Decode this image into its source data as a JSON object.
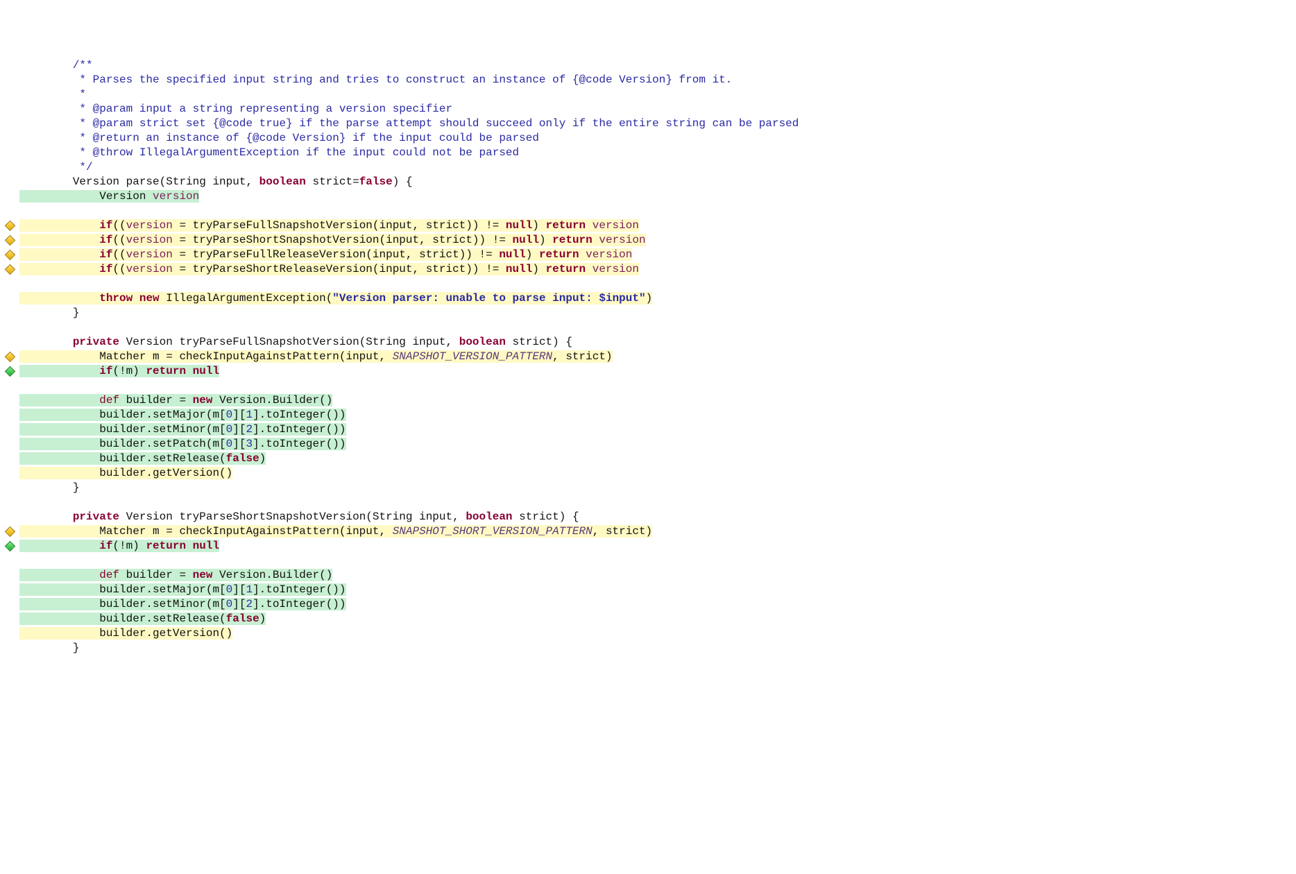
{
  "colors": {
    "keyword": "#880033",
    "comment": "#2a2aa5",
    "string": "#2a2aa5",
    "number": "#2a2aa5",
    "constant": "#5a3a7a",
    "field": "#7a1f5a",
    "bg_green": "#c7f0d2",
    "bg_yellow": "#fff9c4"
  },
  "lines": [
    {
      "gutter": "",
      "segs": [
        {
          "t": "        /**",
          "cls": "t-comment",
          "bg": "bg-none"
        }
      ]
    },
    {
      "gutter": "",
      "segs": [
        {
          "t": "         * Parses the specified input string and tries to construct an instance of {@code Version} from it.",
          "cls": "t-comment",
          "bg": "bg-none"
        }
      ]
    },
    {
      "gutter": "",
      "segs": [
        {
          "t": "         *",
          "cls": "t-comment",
          "bg": "bg-none"
        }
      ]
    },
    {
      "gutter": "",
      "segs": [
        {
          "t": "         * @param input a string representing a version specifier",
          "cls": "t-comment",
          "bg": "bg-none"
        }
      ]
    },
    {
      "gutter": "",
      "segs": [
        {
          "t": "         * @param strict set {@code true} if the parse attempt should succeed only if the entire string can be parsed",
          "cls": "t-comment",
          "bg": "bg-none"
        }
      ]
    },
    {
      "gutter": "",
      "segs": [
        {
          "t": "         * @return an instance of {@code Version} if the input could be parsed",
          "cls": "t-comment",
          "bg": "bg-none"
        }
      ]
    },
    {
      "gutter": "",
      "segs": [
        {
          "t": "         * @throw IllegalArgumentException if the input could not be parsed",
          "cls": "t-comment",
          "bg": "bg-none"
        }
      ]
    },
    {
      "gutter": "",
      "segs": [
        {
          "t": "         */",
          "cls": "t-comment",
          "bg": "bg-none"
        }
      ]
    },
    {
      "gutter": "",
      "segs": [
        {
          "t": "        ",
          "cls": "t-plain",
          "bg": "bg-none"
        },
        {
          "t": "Version parse(String input, ",
          "cls": "t-plain",
          "bg": "bg-none"
        },
        {
          "t": "boolean",
          "cls": "t-keyword",
          "bg": "bg-none"
        },
        {
          "t": " strict=",
          "cls": "t-plain",
          "bg": "bg-none"
        },
        {
          "t": "false",
          "cls": "t-keyword",
          "bg": "bg-none"
        },
        {
          "t": ") {",
          "cls": "t-plain",
          "bg": "bg-none"
        }
      ]
    },
    {
      "gutter": "",
      "segs": [
        {
          "t": "            Version ",
          "cls": "t-plain",
          "bg": "bg-green"
        },
        {
          "t": "version",
          "cls": "t-field",
          "bg": "bg-green"
        }
      ]
    },
    {
      "gutter": "",
      "segs": [
        {
          "t": " ",
          "cls": "t-plain",
          "bg": "bg-none"
        }
      ]
    },
    {
      "gutter": "yellow",
      "segs": [
        {
          "t": "            ",
          "cls": "t-plain",
          "bg": "bg-yellow"
        },
        {
          "t": "if",
          "cls": "t-keyword",
          "bg": "bg-yellow"
        },
        {
          "t": "((",
          "cls": "t-plain",
          "bg": "bg-yellow"
        },
        {
          "t": "version",
          "cls": "t-field",
          "bg": "bg-yellow"
        },
        {
          "t": " = tryParseFullSnapshotVersion(input, strict)) != ",
          "cls": "t-plain",
          "bg": "bg-yellow"
        },
        {
          "t": "null",
          "cls": "t-keyword",
          "bg": "bg-yellow"
        },
        {
          "t": ") ",
          "cls": "t-plain",
          "bg": "bg-yellow"
        },
        {
          "t": "return",
          "cls": "t-keyword",
          "bg": "bg-yellow"
        },
        {
          "t": " ",
          "cls": "t-plain",
          "bg": "bg-yellow"
        },
        {
          "t": "version",
          "cls": "t-field",
          "bg": "bg-yellow"
        }
      ]
    },
    {
      "gutter": "yellow",
      "segs": [
        {
          "t": "            ",
          "cls": "t-plain",
          "bg": "bg-yellow"
        },
        {
          "t": "if",
          "cls": "t-keyword",
          "bg": "bg-yellow"
        },
        {
          "t": "((",
          "cls": "t-plain",
          "bg": "bg-yellow"
        },
        {
          "t": "version",
          "cls": "t-field",
          "bg": "bg-yellow"
        },
        {
          "t": " = tryParseShortSnapshotVersion(input, strict)) != ",
          "cls": "t-plain",
          "bg": "bg-yellow"
        },
        {
          "t": "null",
          "cls": "t-keyword",
          "bg": "bg-yellow"
        },
        {
          "t": ") ",
          "cls": "t-plain",
          "bg": "bg-yellow"
        },
        {
          "t": "return",
          "cls": "t-keyword",
          "bg": "bg-yellow"
        },
        {
          "t": " ",
          "cls": "t-plain",
          "bg": "bg-yellow"
        },
        {
          "t": "version",
          "cls": "t-field",
          "bg": "bg-yellow"
        }
      ]
    },
    {
      "gutter": "yellow",
      "segs": [
        {
          "t": "            ",
          "cls": "t-plain",
          "bg": "bg-yellow"
        },
        {
          "t": "if",
          "cls": "t-keyword",
          "bg": "bg-yellow"
        },
        {
          "t": "((",
          "cls": "t-plain",
          "bg": "bg-yellow"
        },
        {
          "t": "version",
          "cls": "t-field",
          "bg": "bg-yellow"
        },
        {
          "t": " = tryParseFullReleaseVersion(input, strict)) != ",
          "cls": "t-plain",
          "bg": "bg-yellow"
        },
        {
          "t": "null",
          "cls": "t-keyword",
          "bg": "bg-yellow"
        },
        {
          "t": ") ",
          "cls": "t-plain",
          "bg": "bg-yellow"
        },
        {
          "t": "return",
          "cls": "t-keyword",
          "bg": "bg-yellow"
        },
        {
          "t": " ",
          "cls": "t-plain",
          "bg": "bg-yellow"
        },
        {
          "t": "version",
          "cls": "t-field",
          "bg": "bg-yellow"
        }
      ]
    },
    {
      "gutter": "yellow",
      "segs": [
        {
          "t": "            ",
          "cls": "t-plain",
          "bg": "bg-yellow"
        },
        {
          "t": "if",
          "cls": "t-keyword",
          "bg": "bg-yellow"
        },
        {
          "t": "((",
          "cls": "t-plain",
          "bg": "bg-yellow"
        },
        {
          "t": "version",
          "cls": "t-field",
          "bg": "bg-yellow"
        },
        {
          "t": " = tryParseShortReleaseVersion(input, strict)) != ",
          "cls": "t-plain",
          "bg": "bg-yellow"
        },
        {
          "t": "null",
          "cls": "t-keyword",
          "bg": "bg-yellow"
        },
        {
          "t": ") ",
          "cls": "t-plain",
          "bg": "bg-yellow"
        },
        {
          "t": "return",
          "cls": "t-keyword",
          "bg": "bg-yellow"
        },
        {
          "t": " ",
          "cls": "t-plain",
          "bg": "bg-yellow"
        },
        {
          "t": "version",
          "cls": "t-field",
          "bg": "bg-yellow"
        }
      ]
    },
    {
      "gutter": "",
      "segs": [
        {
          "t": " ",
          "cls": "t-plain",
          "bg": "bg-none"
        }
      ]
    },
    {
      "gutter": "",
      "segs": [
        {
          "t": "            ",
          "cls": "t-plain",
          "bg": "bg-yellow"
        },
        {
          "t": "throw",
          "cls": "t-keyword",
          "bg": "bg-yellow"
        },
        {
          "t": " ",
          "cls": "t-plain",
          "bg": "bg-yellow"
        },
        {
          "t": "new",
          "cls": "t-keyword",
          "bg": "bg-yellow"
        },
        {
          "t": " IllegalArgumentException(",
          "cls": "t-plain",
          "bg": "bg-yellow"
        },
        {
          "t": "\"Version parser: unable to parse input: $input\"",
          "cls": "t-string t-bold",
          "bg": "bg-yellow"
        },
        {
          "t": ")",
          "cls": "t-plain",
          "bg": "bg-yellow"
        }
      ]
    },
    {
      "gutter": "",
      "segs": [
        {
          "t": "        }",
          "cls": "t-plain",
          "bg": "bg-none"
        }
      ]
    },
    {
      "gutter": "",
      "segs": [
        {
          "t": " ",
          "cls": "t-plain",
          "bg": "bg-none"
        }
      ]
    },
    {
      "gutter": "",
      "segs": [
        {
          "t": "        ",
          "cls": "t-plain",
          "bg": "bg-none"
        },
        {
          "t": "private",
          "cls": "t-keyword",
          "bg": "bg-none"
        },
        {
          "t": " Version tryParseFullSnapshotVersion(String input, ",
          "cls": "t-plain",
          "bg": "bg-none"
        },
        {
          "t": "boolean",
          "cls": "t-keyword",
          "bg": "bg-none"
        },
        {
          "t": " strict) {",
          "cls": "t-plain",
          "bg": "bg-none"
        }
      ]
    },
    {
      "gutter": "yellow",
      "segs": [
        {
          "t": "            Matcher m = checkInputAgainstPattern(input, ",
          "cls": "t-plain",
          "bg": "bg-yellow"
        },
        {
          "t": "SNAPSHOT_VERSION_PATTERN",
          "cls": "t-const",
          "bg": "bg-yellow"
        },
        {
          "t": ", strict)",
          "cls": "t-plain",
          "bg": "bg-yellow"
        }
      ]
    },
    {
      "gutter": "green",
      "segs": [
        {
          "t": "            ",
          "cls": "t-plain",
          "bg": "bg-green"
        },
        {
          "t": "if",
          "cls": "t-keyword",
          "bg": "bg-green"
        },
        {
          "t": "(!m) ",
          "cls": "t-plain",
          "bg": "bg-green"
        },
        {
          "t": "return",
          "cls": "t-keyword",
          "bg": "bg-green"
        },
        {
          "t": " ",
          "cls": "t-plain",
          "bg": "bg-green"
        },
        {
          "t": "null",
          "cls": "t-keyword",
          "bg": "bg-green"
        }
      ]
    },
    {
      "gutter": "",
      "segs": [
        {
          "t": " ",
          "cls": "t-plain",
          "bg": "bg-none"
        }
      ]
    },
    {
      "gutter": "",
      "segs": [
        {
          "t": "            ",
          "cls": "t-plain",
          "bg": "bg-green"
        },
        {
          "t": "def",
          "cls": "t-keyword-np",
          "bg": "bg-green"
        },
        {
          "t": " builder = ",
          "cls": "t-plain",
          "bg": "bg-green"
        },
        {
          "t": "new",
          "cls": "t-keyword",
          "bg": "bg-green"
        },
        {
          "t": " Version.Builder()",
          "cls": "t-plain",
          "bg": "bg-green"
        }
      ]
    },
    {
      "gutter": "",
      "segs": [
        {
          "t": "            builder.setMajor(m[",
          "cls": "t-plain",
          "bg": "bg-green"
        },
        {
          "t": "0",
          "cls": "t-number",
          "bg": "bg-green"
        },
        {
          "t": "][",
          "cls": "t-plain",
          "bg": "bg-green"
        },
        {
          "t": "1",
          "cls": "t-number",
          "bg": "bg-green"
        },
        {
          "t": "].toInteger())",
          "cls": "t-plain",
          "bg": "bg-green"
        }
      ]
    },
    {
      "gutter": "",
      "segs": [
        {
          "t": "            builder.setMinor(m[",
          "cls": "t-plain",
          "bg": "bg-green"
        },
        {
          "t": "0",
          "cls": "t-number",
          "bg": "bg-green"
        },
        {
          "t": "][",
          "cls": "t-plain",
          "bg": "bg-green"
        },
        {
          "t": "2",
          "cls": "t-number",
          "bg": "bg-green"
        },
        {
          "t": "].toInteger())",
          "cls": "t-plain",
          "bg": "bg-green"
        }
      ]
    },
    {
      "gutter": "",
      "segs": [
        {
          "t": "            builder.setPatch(m[",
          "cls": "t-plain",
          "bg": "bg-green"
        },
        {
          "t": "0",
          "cls": "t-number",
          "bg": "bg-green"
        },
        {
          "t": "][",
          "cls": "t-plain",
          "bg": "bg-green"
        },
        {
          "t": "3",
          "cls": "t-number",
          "bg": "bg-green"
        },
        {
          "t": "].toInteger())",
          "cls": "t-plain",
          "bg": "bg-green"
        }
      ]
    },
    {
      "gutter": "",
      "segs": [
        {
          "t": "            builder.setRelease(",
          "cls": "t-plain",
          "bg": "bg-green"
        },
        {
          "t": "false",
          "cls": "t-keyword",
          "bg": "bg-green"
        },
        {
          "t": ")",
          "cls": "t-plain",
          "bg": "bg-green"
        }
      ]
    },
    {
      "gutter": "",
      "segs": [
        {
          "t": "            builder.getVersion()",
          "cls": "t-plain",
          "bg": "bg-yellow"
        }
      ]
    },
    {
      "gutter": "",
      "segs": [
        {
          "t": "        }",
          "cls": "t-plain",
          "bg": "bg-none"
        }
      ]
    },
    {
      "gutter": "",
      "segs": [
        {
          "t": " ",
          "cls": "t-plain",
          "bg": "bg-none"
        }
      ]
    },
    {
      "gutter": "",
      "segs": [
        {
          "t": "        ",
          "cls": "t-plain",
          "bg": "bg-none"
        },
        {
          "t": "private",
          "cls": "t-keyword",
          "bg": "bg-none"
        },
        {
          "t": " Version tryParseShortSnapshotVersion(String input, ",
          "cls": "t-plain",
          "bg": "bg-none"
        },
        {
          "t": "boolean",
          "cls": "t-keyword",
          "bg": "bg-none"
        },
        {
          "t": " strict) {",
          "cls": "t-plain",
          "bg": "bg-none"
        }
      ]
    },
    {
      "gutter": "yellow",
      "segs": [
        {
          "t": "            Matcher m = checkInputAgainstPattern(input, ",
          "cls": "t-plain",
          "bg": "bg-yellow"
        },
        {
          "t": "SNAPSHOT_SHORT_VERSION_PATTERN",
          "cls": "t-const",
          "bg": "bg-yellow"
        },
        {
          "t": ", strict)",
          "cls": "t-plain",
          "bg": "bg-yellow"
        }
      ]
    },
    {
      "gutter": "green",
      "segs": [
        {
          "t": "            ",
          "cls": "t-plain",
          "bg": "bg-green"
        },
        {
          "t": "if",
          "cls": "t-keyword",
          "bg": "bg-green"
        },
        {
          "t": "(!m) ",
          "cls": "t-plain",
          "bg": "bg-green"
        },
        {
          "t": "return",
          "cls": "t-keyword",
          "bg": "bg-green"
        },
        {
          "t": " ",
          "cls": "t-plain",
          "bg": "bg-green"
        },
        {
          "t": "null",
          "cls": "t-keyword",
          "bg": "bg-green"
        }
      ]
    },
    {
      "gutter": "",
      "segs": [
        {
          "t": " ",
          "cls": "t-plain",
          "bg": "bg-none"
        }
      ]
    },
    {
      "gutter": "",
      "segs": [
        {
          "t": "            ",
          "cls": "t-plain",
          "bg": "bg-green"
        },
        {
          "t": "def",
          "cls": "t-keyword-np",
          "bg": "bg-green"
        },
        {
          "t": " builder = ",
          "cls": "t-plain",
          "bg": "bg-green"
        },
        {
          "t": "new",
          "cls": "t-keyword",
          "bg": "bg-green"
        },
        {
          "t": " Version.Builder()",
          "cls": "t-plain",
          "bg": "bg-green"
        }
      ]
    },
    {
      "gutter": "",
      "segs": [
        {
          "t": "            builder.setMajor(m[",
          "cls": "t-plain",
          "bg": "bg-green"
        },
        {
          "t": "0",
          "cls": "t-number",
          "bg": "bg-green"
        },
        {
          "t": "][",
          "cls": "t-plain",
          "bg": "bg-green"
        },
        {
          "t": "1",
          "cls": "t-number",
          "bg": "bg-green"
        },
        {
          "t": "].toInteger())",
          "cls": "t-plain",
          "bg": "bg-green"
        }
      ]
    },
    {
      "gutter": "",
      "segs": [
        {
          "t": "            builder.setMinor(m[",
          "cls": "t-plain",
          "bg": "bg-green"
        },
        {
          "t": "0",
          "cls": "t-number",
          "bg": "bg-green"
        },
        {
          "t": "][",
          "cls": "t-plain",
          "bg": "bg-green"
        },
        {
          "t": "2",
          "cls": "t-number",
          "bg": "bg-green"
        },
        {
          "t": "].toInteger())",
          "cls": "t-plain",
          "bg": "bg-green"
        }
      ]
    },
    {
      "gutter": "",
      "segs": [
        {
          "t": "            builder.setRelease(",
          "cls": "t-plain",
          "bg": "bg-green"
        },
        {
          "t": "false",
          "cls": "t-keyword",
          "bg": "bg-green"
        },
        {
          "t": ")",
          "cls": "t-plain",
          "bg": "bg-green"
        }
      ]
    },
    {
      "gutter": "",
      "segs": [
        {
          "t": "            builder.getVersion()",
          "cls": "t-plain",
          "bg": "bg-yellow"
        }
      ]
    },
    {
      "gutter": "",
      "segs": [
        {
          "t": "        }",
          "cls": "t-plain",
          "bg": "bg-none"
        }
      ]
    }
  ]
}
